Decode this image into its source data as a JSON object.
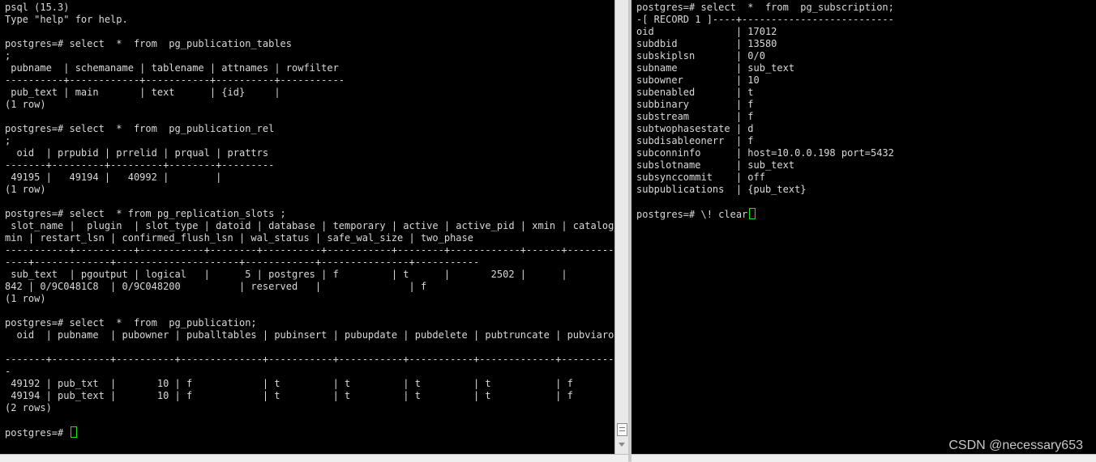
{
  "left_terminal": {
    "lines": [
      "psql (15.3)",
      "Type \"help\" for help.",
      "",
      "postgres=# select  *  from  pg_publication_tables",
      ";",
      " pubname  | schemaname | tablename | attnames | rowfilter",
      "----------+------------+-----------+----------+-----------",
      " pub_text | main       | text      | {id}     |",
      "(1 row)",
      "",
      "postgres=# select  *  from  pg_publication_rel",
      ";",
      "  oid  | prpubid | prrelid | prqual | prattrs",
      "-------+---------+---------+--------+---------",
      " 49195 |   49194 |   40992 |        |",
      "(1 row)",
      "",
      "postgres=# select  * from pg_replication_slots ;",
      " slot_name |  plugin  | slot_type | datoid | database | temporary | active | active_pid | xmin | catalog_x",
      "min | restart_lsn | confirmed_flush_lsn | wal_status | safe_wal_size | two_phase",
      "-----------+----------+-----------+--------+----------+-----------+--------+------------+------+----------",
      "----+-------------+---------------------+------------+---------------+-----------",
      " sub_text  | pgoutput | logical   |      5 | postgres | f         | t      |       2502 |      |",
      "842 | 0/9C0481C8  | 0/9C048200          | reserved   |               | f",
      "(1 row)",
      "",
      "postgres=# select  *  from  pg_publication;",
      "  oid  | pubname  | pubowner | puballtables | pubinsert | pubupdate | pubdelete | pubtruncate | pubviaroot",
      "",
      "-------+----------+----------+--------------+-----------+-----------+-----------+-------------+-----------",
      "-",
      " 49192 | pub_txt  |       10 | f            | t         | t         | t         | t           | f",
      " 49194 | pub_text |       10 | f            | t         | t         | t         | t           | f",
      "(2 rows)",
      ""
    ],
    "prompt": "postgres=# "
  },
  "right_terminal": {
    "lines": [
      "postgres=# select  *  from  pg_subscription;",
      "-[ RECORD 1 ]----+--------------------------",
      "oid              | 17012",
      "subdbid          | 13580",
      "subskiplsn       | 0/0",
      "subname          | sub_text",
      "subowner         | 10",
      "subenabled       | t",
      "subbinary        | f",
      "substream        | f",
      "subtwophasestate | d",
      "subdisableonerr  | f",
      "subconninfo      | host=10.0.0.198 port=5432",
      "subslotname      | sub_text",
      "subsynccommit    | off",
      "subpublications  | {pub_text}",
      ""
    ],
    "prompt": "postgres=# \\! clear"
  },
  "watermark": "CSDN @necessary653",
  "colors": {
    "terminal_bg": "#000000",
    "terminal_fg": "#d9d9d9",
    "cursor": "#17e317"
  }
}
